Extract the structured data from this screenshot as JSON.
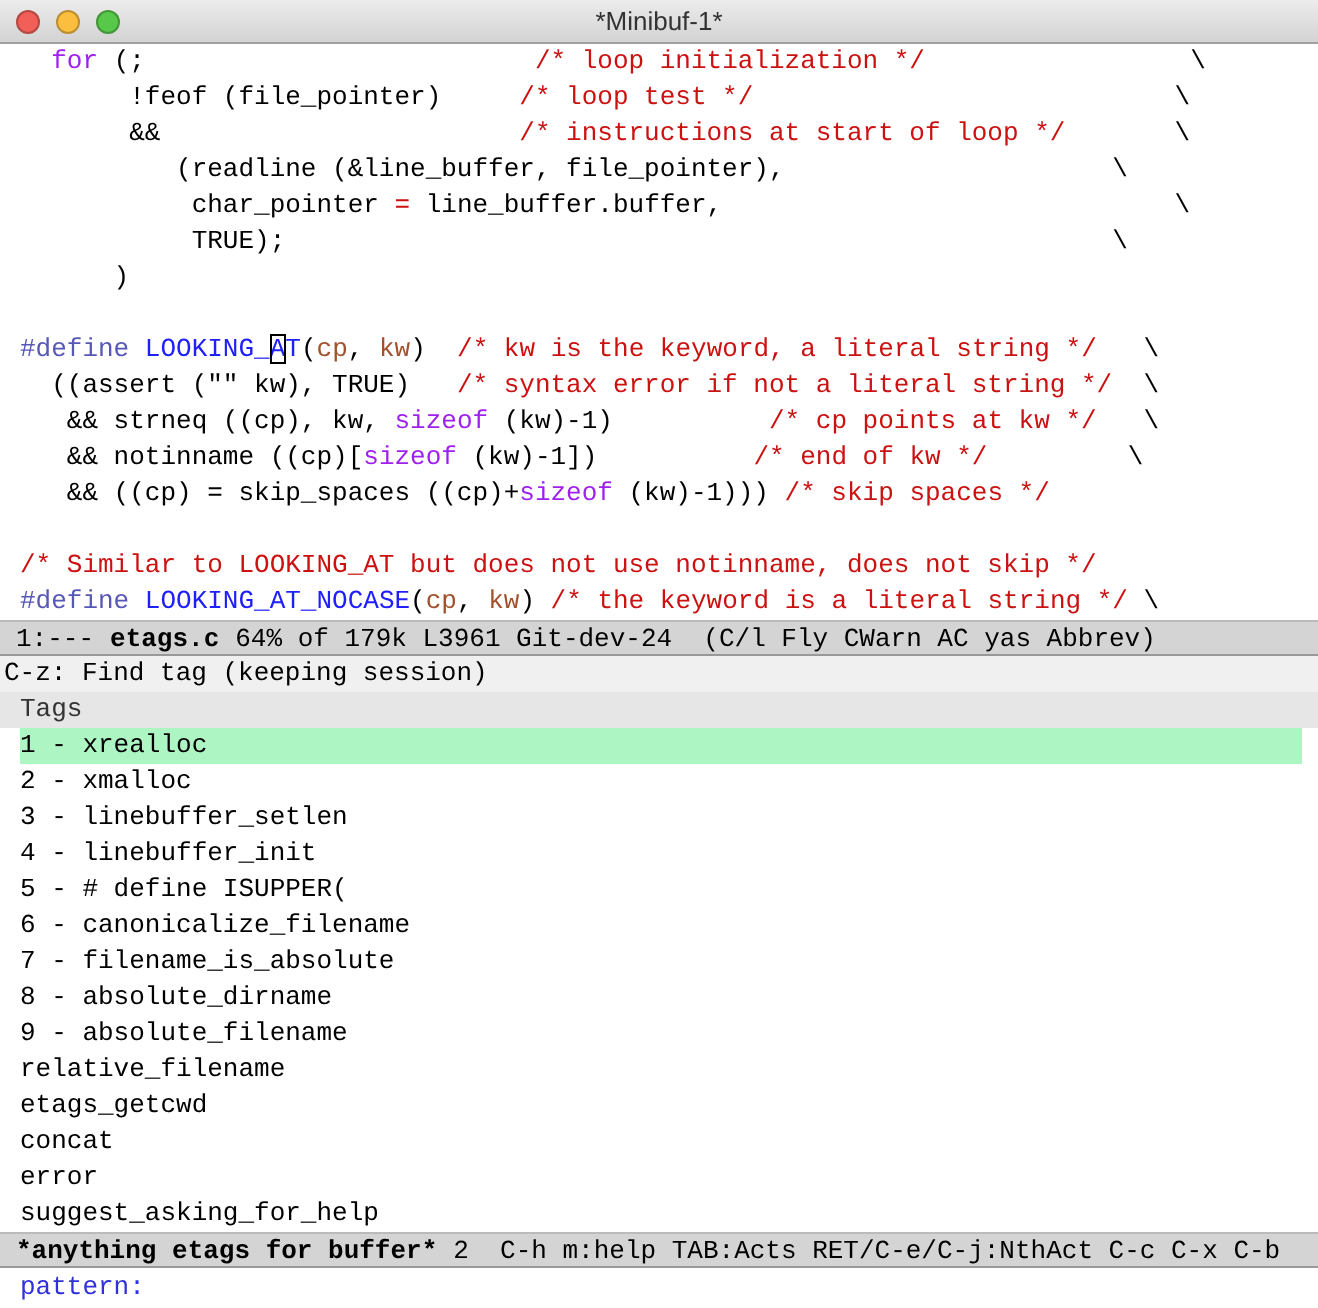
{
  "window": {
    "title": "*Minibuf-1*"
  },
  "code_lines": [
    {
      "kind": "code",
      "segments": [
        {
          "kind": "keyword",
          "text": "  for"
        },
        {
          "kind": "plain",
          "text": " (;                         "
        },
        {
          "kind": "comment",
          "text": "/* loop initialization */"
        },
        {
          "kind": "plain",
          "text": "                 \\"
        }
      ]
    },
    {
      "kind": "code",
      "segments": [
        {
          "kind": "plain",
          "text": "       !feof (file_pointer)     "
        },
        {
          "kind": "comment",
          "text": "/* loop test */"
        },
        {
          "kind": "plain",
          "text": "                           \\"
        }
      ]
    },
    {
      "kind": "code",
      "segments": [
        {
          "kind": "plain",
          "text": "       &&                       "
        },
        {
          "kind": "comment",
          "text": "/* instructions at start of loop */"
        },
        {
          "kind": "plain",
          "text": "       \\"
        }
      ]
    },
    {
      "kind": "code",
      "segments": [
        {
          "kind": "plain",
          "text": "          (readline (&line_buffer, file_pointer),                     \\"
        }
      ]
    },
    {
      "kind": "code",
      "segments": [
        {
          "kind": "plain",
          "text": "           char_pointer "
        },
        {
          "kind": "op",
          "text": "="
        },
        {
          "kind": "plain",
          "text": " line_buffer.buffer,                             \\"
        }
      ]
    },
    {
      "kind": "code",
      "segments": [
        {
          "kind": "plain",
          "text": "           TRUE);                                                     \\"
        }
      ]
    },
    {
      "kind": "code",
      "segments": [
        {
          "kind": "plain",
          "text": "      )"
        }
      ]
    },
    {
      "kind": "blank"
    },
    {
      "kind": "code",
      "segments": [
        {
          "kind": "preproc",
          "text": "#define "
        },
        {
          "kind": "func",
          "text": "LOOKING_"
        },
        {
          "kind": "cursor",
          "text": "A"
        },
        {
          "kind": "func",
          "text": "T"
        },
        {
          "kind": "plain",
          "text": "("
        },
        {
          "kind": "var",
          "text": "cp"
        },
        {
          "kind": "plain",
          "text": ", "
        },
        {
          "kind": "var",
          "text": "kw"
        },
        {
          "kind": "plain",
          "text": ")  "
        },
        {
          "kind": "comment",
          "text": "/* kw is the keyword, a literal string */"
        },
        {
          "kind": "plain",
          "text": "   \\"
        }
      ]
    },
    {
      "kind": "code",
      "segments": [
        {
          "kind": "plain",
          "text": "  ((assert (\"\" kw), TRUE)   "
        },
        {
          "kind": "comment",
          "text": "/* syntax error if not a literal string */"
        },
        {
          "kind": "plain",
          "text": "  \\"
        }
      ]
    },
    {
      "kind": "code",
      "segments": [
        {
          "kind": "plain",
          "text": "   && strneq ((cp), kw, "
        },
        {
          "kind": "keyword",
          "text": "sizeof"
        },
        {
          "kind": "plain",
          "text": " (kw)-1)          "
        },
        {
          "kind": "comment",
          "text": "/* cp points at kw */"
        },
        {
          "kind": "plain",
          "text": "   \\"
        }
      ]
    },
    {
      "kind": "code",
      "segments": [
        {
          "kind": "plain",
          "text": "   && notinname ((cp)["
        },
        {
          "kind": "keyword",
          "text": "sizeof"
        },
        {
          "kind": "plain",
          "text": " (kw)-1])          "
        },
        {
          "kind": "comment",
          "text": "/* end of kw */"
        },
        {
          "kind": "plain",
          "text": "         \\"
        }
      ]
    },
    {
      "kind": "code",
      "segments": [
        {
          "kind": "plain",
          "text": "   && ((cp) = skip_spaces ((cp)+"
        },
        {
          "kind": "keyword",
          "text": "sizeof"
        },
        {
          "kind": "plain",
          "text": " (kw)-1))) "
        },
        {
          "kind": "comment",
          "text": "/* skip spaces */"
        }
      ]
    },
    {
      "kind": "blank"
    },
    {
      "kind": "code",
      "segments": [
        {
          "kind": "comment",
          "text": "/* Similar to LOOKING_AT but does not use notinname, does not skip */"
        }
      ]
    },
    {
      "kind": "code",
      "segments": [
        {
          "kind": "preproc",
          "text": "#define "
        },
        {
          "kind": "func",
          "text": "LOOKING_AT_NOCASE"
        },
        {
          "kind": "plain",
          "text": "("
        },
        {
          "kind": "var",
          "text": "cp"
        },
        {
          "kind": "plain",
          "text": ", "
        },
        {
          "kind": "var",
          "text": "kw"
        },
        {
          "kind": "plain",
          "text": ") "
        },
        {
          "kind": "comment",
          "text": "/* the keyword is a literal string */"
        },
        {
          "kind": "plain",
          "text": " \\"
        }
      ]
    }
  ],
  "mode_line": {
    "status": "1:---",
    "buffer": "etags.c",
    "info": "64% of 179k L3961 Git-dev-24  (C/l Fly CWarn AC yas Abbrev)"
  },
  "minibuffer_prompt": "C-z: Find tag (keeping session)",
  "tags": {
    "header": "Tags",
    "items": [
      {
        "text": "1 - xrealloc",
        "selected": true
      },
      {
        "text": "2 - xmalloc",
        "selected": false
      },
      {
        "text": "3 - linebuffer_setlen",
        "selected": false
      },
      {
        "text": "4 - linebuffer_init",
        "selected": false
      },
      {
        "text": "5 - # define ISUPPER(",
        "selected": false
      },
      {
        "text": "6 - canonicalize_filename",
        "selected": false
      },
      {
        "text": "7 - filename_is_absolute",
        "selected": false
      },
      {
        "text": "8 - absolute_dirname",
        "selected": false
      },
      {
        "text": "9 - absolute_filename",
        "selected": false
      },
      {
        "text": "relative_filename",
        "selected": false
      },
      {
        "text": "etags_getcwd",
        "selected": false
      },
      {
        "text": "concat",
        "selected": false
      },
      {
        "text": "error",
        "selected": false
      },
      {
        "text": "suggest_asking_for_help",
        "selected": false
      }
    ]
  },
  "anything_mode_line": {
    "buffer": "*anything etags for buffer*",
    "info": "2  C-h m:help TAB:Acts RET/C-e/C-j:NthAct C-c C-x C-b"
  },
  "pattern_prompt": "pattern:"
}
